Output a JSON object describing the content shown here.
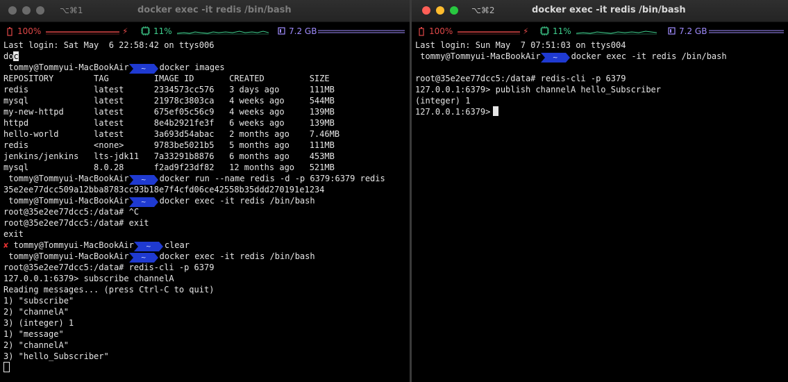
{
  "colors": {
    "close": "#ff5f57",
    "minimize": "#febc2e",
    "zoom": "#28c840",
    "inactive": "#6b6b6b",
    "prompt_bg": "#1f3ad1",
    "error": "#e03030",
    "battery": "#e04848",
    "cpu": "#3fcf8e",
    "memory": "#a08cff"
  },
  "left": {
    "tab_id": "⌥⌘1",
    "title": "docker exec -it redis /bin/bash",
    "status": {
      "battery_icon": "battery-icon",
      "battery": "100%",
      "charging_icon": "bolt-icon",
      "cpu_icon": "chip-icon",
      "cpu": "11%",
      "mem_icon": "memory-icon",
      "mem": "7.2 GB"
    },
    "lines": [
      {
        "type": "text",
        "text": "Last login: Sat May  6 22:58:42 on ttys006"
      },
      {
        "type": "typed",
        "before": "do",
        "cursor": "c"
      },
      {
        "type": "prompt",
        "user": "tommy@Tommyui-MacBookAir",
        "dir": "~",
        "cmd": "docker images"
      },
      {
        "type": "text",
        "text": "REPOSITORY        TAG         IMAGE ID       CREATED         SIZE"
      },
      {
        "type": "text",
        "text": "redis             latest      2334573cc576   3 days ago      111MB"
      },
      {
        "type": "text",
        "text": "mysql             latest      21978c3803ca   4 weeks ago     544MB"
      },
      {
        "type": "text",
        "text": "my-new-httpd      latest      675ef05c56c9   4 weeks ago     139MB"
      },
      {
        "type": "text",
        "text": "httpd             latest      8e4b2921fe3f   6 weeks ago     139MB"
      },
      {
        "type": "text",
        "text": "hello-world       latest      3a693d54abac   2 months ago    7.46MB"
      },
      {
        "type": "text",
        "text": "redis             <none>      9783be5021b5   5 months ago    111MB"
      },
      {
        "type": "text",
        "text": "jenkins/jenkins   lts-jdk11   7a33291b8876   6 months ago    453MB"
      },
      {
        "type": "text",
        "text": "mysql             8.0.28      f2ad9f23df82   12 months ago   521MB"
      },
      {
        "type": "prompt",
        "user": "tommy@Tommyui-MacBookAir",
        "dir": "~",
        "cmd": "docker run --name redis -d -p 6379:6379 redis"
      },
      {
        "type": "text",
        "text": "35e2ee77dcc509a12bba8783cc93b18e7f4cfd06ce42558b35ddd270191e1234"
      },
      {
        "type": "prompt",
        "user": "tommy@Tommyui-MacBookAir",
        "dir": "~",
        "cmd": "docker exec -it redis /bin/bash"
      },
      {
        "type": "text",
        "text": "root@35e2ee77dcc5:/data# ^C"
      },
      {
        "type": "text",
        "text": "root@35e2ee77dcc5:/data# exit"
      },
      {
        "type": "text",
        "text": "exit"
      },
      {
        "type": "prompt",
        "err": "✘",
        "user": "tommy@Tommyui-MacBookAir",
        "dir": "~",
        "cmd": "clear"
      },
      {
        "type": "prompt",
        "user": "tommy@Tommyui-MacBookAir",
        "dir": "~",
        "cmd": "docker exec -it redis /bin/bash"
      },
      {
        "type": "text",
        "text": "root@35e2ee77dcc5:/data# redis-cli -p 6379"
      },
      {
        "type": "text",
        "text": "127.0.0.1:6379> subscribe channelA"
      },
      {
        "type": "text",
        "text": "Reading messages... (press Ctrl-C to quit)"
      },
      {
        "type": "text",
        "text": "1) \"subscribe\""
      },
      {
        "type": "text",
        "text": "2) \"channelA\""
      },
      {
        "type": "text",
        "text": "3) (integer) 1"
      },
      {
        "type": "text",
        "text": "1) \"message\""
      },
      {
        "type": "text",
        "text": "2) \"channelA\""
      },
      {
        "type": "text",
        "text": "3) \"hello_Subscriber\""
      },
      {
        "type": "cursor",
        "style": "box"
      }
    ]
  },
  "right": {
    "tab_id": "⌥⌘2",
    "title": "docker exec -it redis /bin/bash",
    "status": {
      "battery_icon": "battery-icon",
      "battery": "100%",
      "charging_icon": "bolt-icon",
      "cpu_icon": "chip-icon",
      "cpu": "11%",
      "mem_icon": "memory-icon",
      "mem": "7.2 GB"
    },
    "lines": [
      {
        "type": "text",
        "text": "Last login: Sun May  7 07:51:03 on ttys004"
      },
      {
        "type": "prompt",
        "user": "tommy@Tommyui-MacBookAir",
        "dir": "~",
        "cmd": "docker exec -it redis /bin/bash"
      },
      {
        "type": "text",
        "text": ""
      },
      {
        "type": "text",
        "text": "root@35e2ee77dcc5:/data# redis-cli -p 6379"
      },
      {
        "type": "text",
        "text": "127.0.0.1:6379> publish channelA hello_Subscriber"
      },
      {
        "type": "text",
        "text": "(integer) 1"
      },
      {
        "type": "text",
        "before": "127.0.0.1:6379>",
        "cursor": "solid"
      }
    ]
  }
}
